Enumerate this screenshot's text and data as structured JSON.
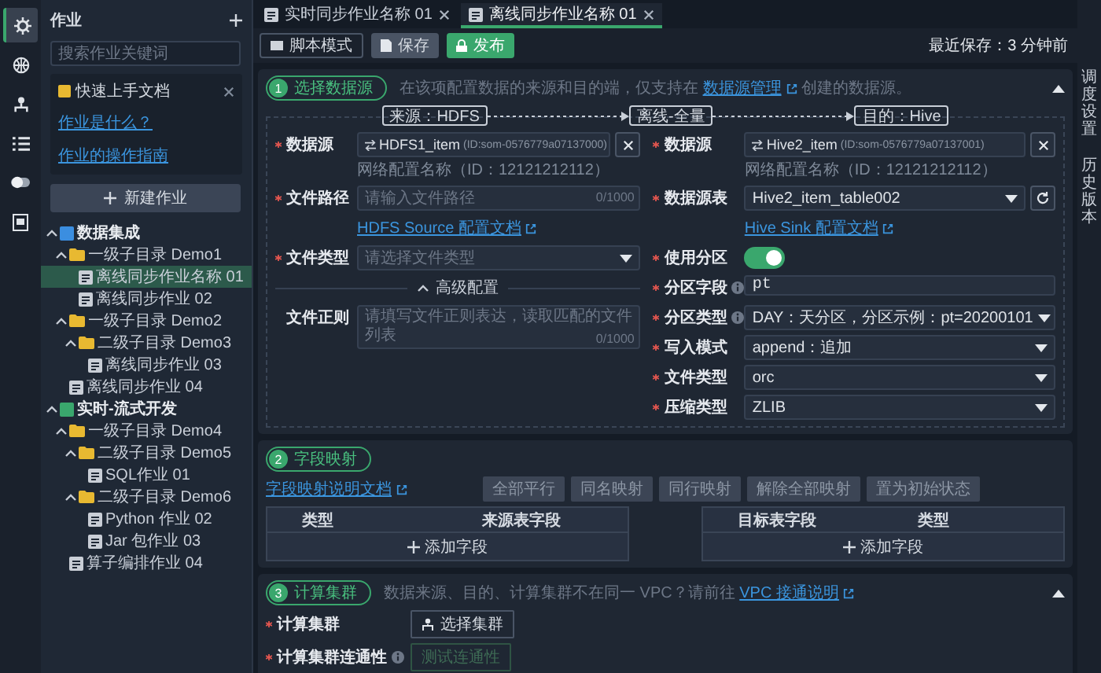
{
  "rail": [
    {
      "selected": true
    },
    {
      "selected": false
    },
    {
      "selected": false
    },
    {
      "selected": false
    },
    {
      "selected": false
    },
    {
      "selected": false
    }
  ],
  "sidebar": {
    "title": "作业",
    "search": {
      "placeholder": "搜索作业关键词"
    },
    "help": {
      "title": "快速上手文档",
      "links": [
        "作业是什么？",
        "作业的操作指南"
      ]
    },
    "new_button": "新建作业",
    "tree": [
      {
        "kind": "group",
        "label": "数据集成",
        "color": "#3b8ee0",
        "expanded": true,
        "selected": false,
        "children": [
          {
            "kind": "folder",
            "label": "一级子目录 Demo1",
            "expanded": true,
            "selected": false,
            "children": [
              {
                "kind": "job",
                "label": "离线同步作业名称 01",
                "selected": true
              },
              {
                "kind": "job",
                "label": "离线同步作业 02",
                "selected": false
              }
            ]
          },
          {
            "kind": "folder",
            "label": "一级子目录 Demo2",
            "expanded": true,
            "selected": false,
            "children": [
              {
                "kind": "folder",
                "label": "二级子目录 Demo3",
                "expanded": true,
                "selected": false,
                "children": [
                  {
                    "kind": "job",
                    "label": "离线同步作业 03",
                    "selected": false
                  }
                ]
              }
            ]
          },
          {
            "kind": "job",
            "label": "离线同步作业 04",
            "selected": false
          }
        ]
      },
      {
        "kind": "group",
        "label": "实时-流式开发",
        "color": "#3aa76d",
        "expanded": true,
        "selected": false,
        "children": [
          {
            "kind": "folder",
            "label": "一级子目录 Demo4",
            "expanded": true,
            "selected": false,
            "children": [
              {
                "kind": "folder",
                "label": "二级子目录 Demo5",
                "expanded": true,
                "selected": false,
                "children": [
                  {
                    "kind": "job",
                    "label": "SQL作业 01",
                    "selected": false
                  }
                ]
              },
              {
                "kind": "folder",
                "label": "二级子目录 Demo6",
                "expanded": true,
                "selected": false,
                "children": [
                  {
                    "kind": "job",
                    "label": "Python 作业 02",
                    "selected": false
                  },
                  {
                    "kind": "job",
                    "label": "Jar 包作业 03",
                    "selected": false
                  }
                ]
              }
            ]
          },
          {
            "kind": "job",
            "label": "算子编排作业 04",
            "selected": false
          }
        ]
      }
    ]
  },
  "tabs": [
    {
      "label": "实时同步作业名称 01",
      "selected": false
    },
    {
      "label": "离线同步作业名称 01",
      "selected": true
    }
  ],
  "toolbar": {
    "buttons": [
      {
        "kind": "outline",
        "label": "脚本模式"
      },
      {
        "kind": "grey",
        "label": "保存"
      },
      {
        "kind": "primary",
        "label": "发布"
      }
    ],
    "last_saved": "最近保存：3 分钟前"
  },
  "source": {
    "number": "1",
    "title": "选择数据源",
    "hint_before": "在该项配置数据的来源和目的端，仅支持在",
    "hint_link": "数据源管理",
    "hint_after": "创建的数据源。",
    "expanded": true,
    "flow": [
      "来源：HDFS",
      "离线-全量",
      "目的：Hive"
    ],
    "left": [
      {
        "kind": "datasource",
        "label": "数据源",
        "required": true,
        "name": "HDFS1_item",
        "id": "(ID:som-0576779a07137000)",
        "note": "网络配置名称（ID：12121212112）"
      },
      {
        "kind": "input",
        "label": "文件路径",
        "required": true,
        "placeholder": "请输入文件路径",
        "counter": "0/1000",
        "link": "HDFS Source 配置文档"
      },
      {
        "kind": "select",
        "label": "文件类型",
        "required": true,
        "placeholder": "请选择文件类型"
      },
      {
        "kind": "divider",
        "label": "高级配置",
        "expanded": true
      },
      {
        "kind": "textarea",
        "label": "文件正则",
        "placeholder": "请填写文件正则表达，读取匹配的文件列表",
        "counter": "0/1000"
      }
    ],
    "right": [
      {
        "kind": "datasource",
        "label": "数据源",
        "required": true,
        "name": "Hive2_item",
        "id": "(ID:som-0576779a07137001)",
        "note": "网络配置名称（ID：12121212112）"
      },
      {
        "kind": "select",
        "label": "数据源表",
        "required": true,
        "value": "Hive2_item_table002",
        "refresh": true,
        "link": "Hive Sink 配置文档"
      },
      {
        "kind": "toggle",
        "label": "使用分区",
        "required": true,
        "on": true
      },
      {
        "kind": "text",
        "label": "分区字段",
        "required": true,
        "info": true,
        "value": "pt"
      },
      {
        "kind": "select",
        "label": "分区类型",
        "required": true,
        "info": true,
        "value": "DAY：天分区，分区示例：pt=20200101"
      },
      {
        "kind": "select",
        "label": "写入模式",
        "required": true,
        "value": "append：追加"
      },
      {
        "kind": "select",
        "label": "文件类型",
        "required": true,
        "value": "orc"
      },
      {
        "kind": "select",
        "label": "压缩类型",
        "required": true,
        "value": "ZLIB"
      }
    ]
  },
  "mapping": {
    "number": "2",
    "title": "字段映射",
    "doc_link": "字段映射说明文档",
    "buttons": [
      {
        "label": "全部平行",
        "disabled": true
      },
      {
        "label": "同名映射",
        "disabled": true
      },
      {
        "label": "同行映射",
        "disabled": true
      },
      {
        "label": "解除全部映射",
        "disabled": true
      },
      {
        "label": "置为初始状态",
        "disabled": true
      }
    ],
    "tables": [
      {
        "columns": [
          "类型",
          "来源表字段"
        ],
        "add": "添加字段"
      },
      {
        "columns": [
          "目标表字段",
          "类型"
        ],
        "add": "添加字段"
      }
    ]
  },
  "cluster": {
    "number": "3",
    "title": "计算集群",
    "hint_before": "数据来源、目的、计算集群不在同一 VPC？请前往",
    "hint_link": "VPC 接通说明",
    "expanded": true,
    "rows": [
      {
        "label": "计算集群",
        "required": true,
        "button": "选择集群",
        "disabled": false
      },
      {
        "label": "计算集群连通性",
        "required": true,
        "info": true,
        "button": "测试连通性",
        "disabled": true
      }
    ]
  },
  "right_rail": [
    {
      "label": "调度设置"
    },
    {
      "label": "历史版本"
    }
  ]
}
